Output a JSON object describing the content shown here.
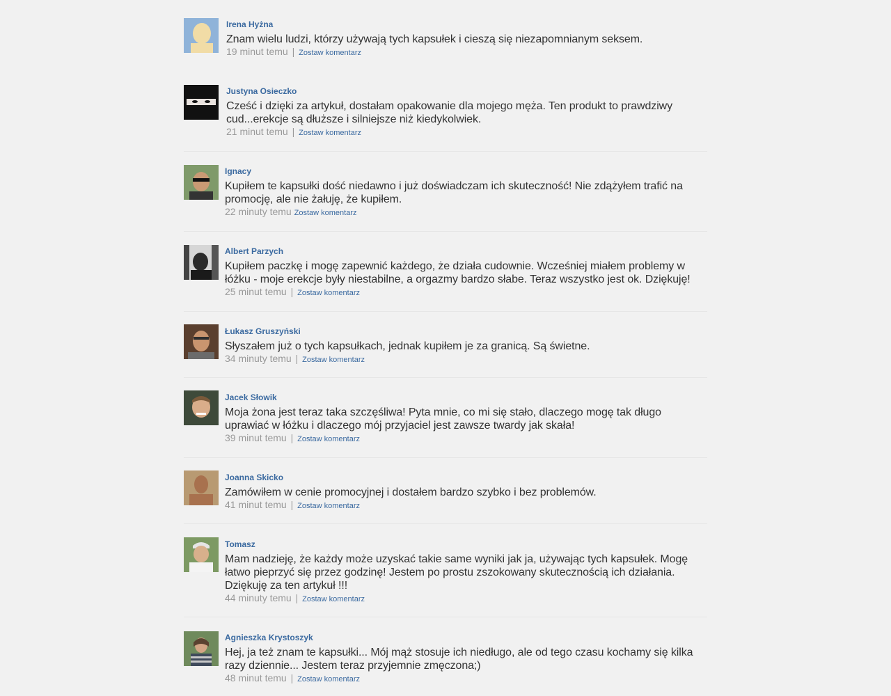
{
  "comments": [
    {
      "author": "Irena Hyżna",
      "text": "Znam wielu ludzi, którzy używają tych kapsułek i cieszą się niezapomnianym seksem.",
      "time": "19 minut temu",
      "sep": "|",
      "reply": "Zostaw komentarz",
      "avatar_bg": "#8fb3d9",
      "avatar_fg": "#f1dca6"
    },
    {
      "author": "Justyna Osieczko",
      "text": "Cześć i dzięki za artykuł, dostałam opakowanie dla mojego męża. Ten produkt to prawdziwy cud...erekcje są dłuższe i silniejsze niż kiedykolwiek.",
      "time": "21 minut temu",
      "sep": "|",
      "reply": "Zostaw komentarz",
      "avatar_bg": "#111111",
      "avatar_fg": "#e9e3df"
    },
    {
      "author": "Ignacy",
      "text": "Kupiłem te kapsułki dość niedawno i już doświadczam ich skuteczność! Nie zdążyłem trafić na promocję, ale nie żałuję, że kupiłem.",
      "time": "22 minuty temu",
      "sep": "",
      "reply": "Zostaw komentarz",
      "avatar_bg": "#7f9a6a",
      "avatar_fg": "#c99a74"
    },
    {
      "author": "Albert Parzych",
      "text": "Kupiłem paczkę i mogę zapewnić każdego, że działa cudownie. Wcześniej miałem problemy w łóżku - moje erekcje były niestabilne, a orgazmy bardzo słabe. Teraz wszystko jest ok. Dziękuję!",
      "time": "25 minut temu",
      "sep": "|",
      "reply": "Zostaw komentarz",
      "avatar_bg": "#d6d6d6",
      "avatar_fg": "#2a2a2a"
    },
    {
      "author": "Łukasz Gruszyński",
      "text": "Słyszałem już o tych kapsułkach, jednak kupiłem je za granicą. Są świetne.",
      "time": "34 minuty temu",
      "sep": "|",
      "reply": "Zostaw komentarz",
      "avatar_bg": "#5a3f2e",
      "avatar_fg": "#c9956f"
    },
    {
      "author": "Jacek Słowik",
      "text": "Moja żona jest teraz taka szczęśliwa! Pyta mnie, co mi się stało, dlaczego mogę tak długo uprawiać w łóżku i dlaczego mój przyjaciel jest zawsze twardy jak skała!",
      "time": "39 minut temu",
      "sep": "|",
      "reply": "Zostaw komentarz",
      "avatar_bg": "#3e4a3a",
      "avatar_fg": "#d9ad8a"
    },
    {
      "author": "Joanna Skicko",
      "text": "Zamówiłem w cenie promocyjnej i dostałem bardzo szybko i bez problemów.",
      "time": "41 minut temu",
      "sep": "|",
      "reply": "Zostaw komentarz",
      "avatar_bg": "#b89a72",
      "avatar_fg": "#a8714e"
    },
    {
      "author": "Tomasz",
      "text": "Mam nadzieję, że każdy może uzyskać takie same wyniki jak ja, używając tych kapsułek. Mogę łatwo pieprzyć się przez godzinę! Jestem po prostu zszokowany skutecznością ich działania. Dziękuję za ten artykuł !!!",
      "time": "44 minuty temu",
      "sep": "|",
      "reply": "Zostaw komentarz",
      "avatar_bg": "#7d9a63",
      "avatar_fg": "#d8b08c"
    },
    {
      "author": "Agnieszka Krystoszyk",
      "text": "Hej, ja też znam te kapsułki... Mój mąż stosuje ich niedługo, ale od tego czasu kochamy się kilka razy dziennie... Jestem teraz przyjemnie zmęczona;)",
      "time": "48 minut temu",
      "sep": "|",
      "reply": "Zostaw komentarz",
      "avatar_bg": "#6f8a5c",
      "avatar_fg": "#d3a585"
    }
  ]
}
